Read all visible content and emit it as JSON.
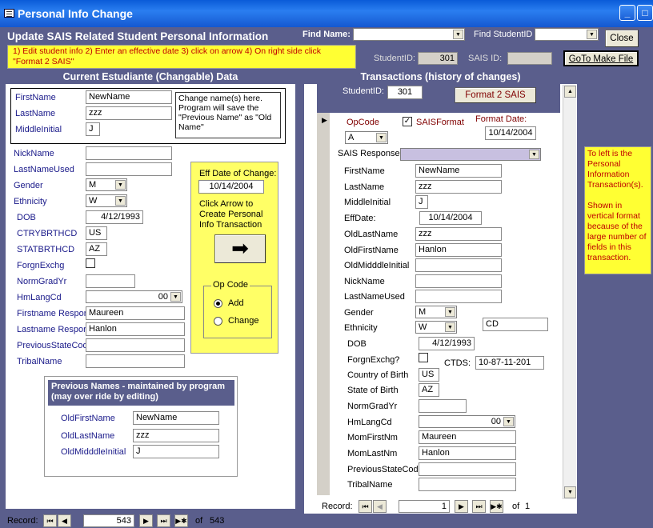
{
  "window": {
    "title": "Personal Info Change",
    "min": "_",
    "max": "□",
    "close": "✕"
  },
  "header": {
    "title": "Update SAIS Related Student Personal Information",
    "instructions": "1) Edit student info 2) Enter an effective date 3) click on arrow 4) On right side click \"Format 2 SAIS\"",
    "find_name_label": "Find Name:",
    "find_student_id_label": "Find StudentID",
    "close_label": "Close",
    "student_id_label": "StudentID:",
    "student_id_value": "301",
    "sais_id_label": "SAIS ID:",
    "sais_id_value": "",
    "goto_label": "GoTo Make File"
  },
  "left": {
    "title": "Current Estudiante (Changable) Data",
    "names": [
      {
        "label": "FirstName",
        "value": "NewName"
      },
      {
        "label": "LastName",
        "value": "zzz"
      },
      {
        "label": "MiddleInitial",
        "value": "J"
      }
    ],
    "change_note": "Change name(s) here. Program will save the \"Previous Name\" as \"Old Name\"",
    "fields": {
      "nickname": {
        "label": "NickName",
        "value": ""
      },
      "lastnameused": {
        "label": "LastNameUsed",
        "value": ""
      },
      "gender": {
        "label": "Gender",
        "value": "M"
      },
      "ethnicity": {
        "label": "Ethnicity",
        "value": "W"
      },
      "dob": {
        "label": "DOB",
        "value": "4/12/1993"
      },
      "ctry": {
        "label": "CTRYBRTHCD",
        "value": "US"
      },
      "stat": {
        "label": "STATBRTHCD",
        "value": "AZ"
      },
      "forgn": {
        "label": "ForgnExchg"
      },
      "normgrad": {
        "label": "NormGradYr",
        "value": ""
      },
      "hmlang": {
        "label": "HmLangCd",
        "value": "00"
      },
      "firstresp": {
        "label": "Firstname Respon",
        "value": "Maureen"
      },
      "lastresp": {
        "label": "Lastname Respor",
        "value": "Hanlon"
      },
      "prevstate": {
        "label": "PreviousStateCod",
        "value": ""
      },
      "tribal": {
        "label": "TribalName",
        "value": ""
      }
    },
    "eff": {
      "label": "Eff Date of Change:",
      "value": "10/14/2004",
      "click_note": "Click Arrow to Create Personal Info Transaction",
      "opcode_label": "Op Code",
      "add_label": "Add",
      "change_label": "Change"
    },
    "prev_names": {
      "title": "Previous Names - maintained by program (may over ride by editing)",
      "items": [
        {
          "label": "OldFirstName",
          "value": "NewName"
        },
        {
          "label": "OldLastName",
          "value": "zzz"
        },
        {
          "label": "OldMidddleInitial",
          "value": "J"
        }
      ]
    }
  },
  "right": {
    "title": "Transactions (history of changes)",
    "student_id_label": "StudentID:",
    "student_id_value": "301",
    "format_btn": "Format 2 SAIS",
    "opcode_label": "OpCode",
    "opcode_value": "A",
    "saisformat_label": "SAISFormat",
    "saisformat_check": "✓",
    "format_date_label": "Format Date:",
    "format_date_value": "10/14/2004",
    "sais_response_label": "SAIS Response:",
    "fields": {
      "firstname": {
        "label": "FirstName",
        "value": "NewName"
      },
      "lastname": {
        "label": "LastName",
        "value": "zzz"
      },
      "middle": {
        "label": "MiddleInitial",
        "value": "J"
      },
      "effdate": {
        "label": "EffDate:",
        "value": "10/14/2004"
      },
      "oldlast": {
        "label": "OldLastName",
        "value": "zzz"
      },
      "oldfirst": {
        "label": "OldFirstName",
        "value": "Hanlon"
      },
      "oldmid": {
        "label": "OldMidddleInitial",
        "value": ""
      },
      "nick": {
        "label": "NickName",
        "value": ""
      },
      "lnu": {
        "label": "LastNameUsed",
        "value": ""
      },
      "gender": {
        "label": "Gender",
        "value": "M"
      },
      "ethnicity": {
        "label": "Ethnicity",
        "value": "W"
      },
      "cd": {
        "value": "CD"
      },
      "dob": {
        "label": "DOB",
        "value": "4/12/1993"
      },
      "forgn": {
        "label": "ForgnExchg?"
      },
      "ctds": {
        "label": "CTDS:",
        "value": "10-87-11-201"
      },
      "country": {
        "label": "Country of Birth",
        "value": "US"
      },
      "state": {
        "label": "State of Birth",
        "value": "AZ"
      },
      "normgrad": {
        "label": "NormGradYr",
        "value": ""
      },
      "hmlang": {
        "label": "HmLangCd",
        "value": "00"
      },
      "momfirst": {
        "label": "MomFirstNm",
        "value": "Maureen"
      },
      "momlast": {
        "label": "MomLastNm",
        "value": "Hanlon"
      },
      "prevstate": {
        "label": "PreviousStateCod",
        "value": ""
      },
      "tribal": {
        "label": "TribalName",
        "value": ""
      }
    },
    "nav": {
      "label": "Record:",
      "current": "1",
      "of": "of",
      "total": "1"
    }
  },
  "side_note": "To left is the Personal Information Transaction(s).\n\nShown in vertical format because of the large number of fields in this transaction.",
  "nav": {
    "label": "Record:",
    "current": "543",
    "of": "of",
    "total": "543"
  },
  "nav_glyphs": {
    "first": "⏮",
    "prev": "◀",
    "next": "▶",
    "last": "⏭",
    "new": "▶✱"
  },
  "arrow_glyph": "➡",
  "dropdown_glyph": "▼",
  "record_selector_glyph": "▶"
}
